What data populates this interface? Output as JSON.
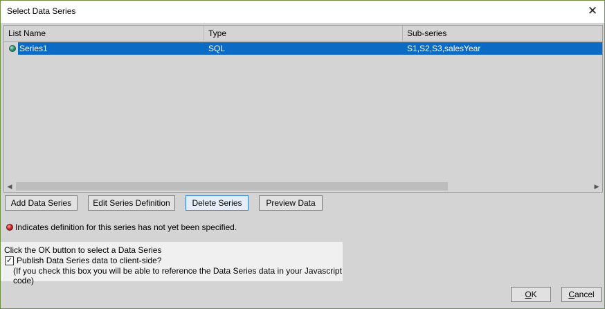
{
  "dialog": {
    "title": "Select Data Series",
    "close_glyph": "✕"
  },
  "list": {
    "columns": [
      "List Name",
      "Type",
      "Sub-series"
    ],
    "rows": [
      {
        "name": "Series1",
        "type": "SQL",
        "subseries": "S1,S2,S3,salesYear"
      }
    ]
  },
  "scrollbar": {
    "left_arrow": "◀",
    "right_arrow": "▶"
  },
  "buttons": {
    "add": "Add Data Series",
    "edit": "Edit Series Definition",
    "delete": "Delete Series",
    "preview": "Preview Data"
  },
  "note": {
    "text": "Indicates definition for this series has not yet been specified."
  },
  "publish": {
    "instruction": "Click the OK button to select a Data Series",
    "checkbox_label": "Publish Data Series data to client-side?",
    "checked": true,
    "check_glyph": "✓",
    "hint": "(If you check this box you will be able to reference the Data Series data in your Javascript code)"
  },
  "footer": {
    "ok_mnemonic": "O",
    "ok_rest": "K",
    "cancel_mnemonic": "C",
    "cancel_rest": "ancel"
  },
  "icons": {
    "series_status": "globe-icon",
    "undefined_marker": "red-dot-icon"
  },
  "colors": {
    "selection": "#0b6bc4",
    "dialog_bg": "#d4d4d4",
    "panel_bg": "#f0f0f0",
    "focus_border": "#2b79d1"
  }
}
